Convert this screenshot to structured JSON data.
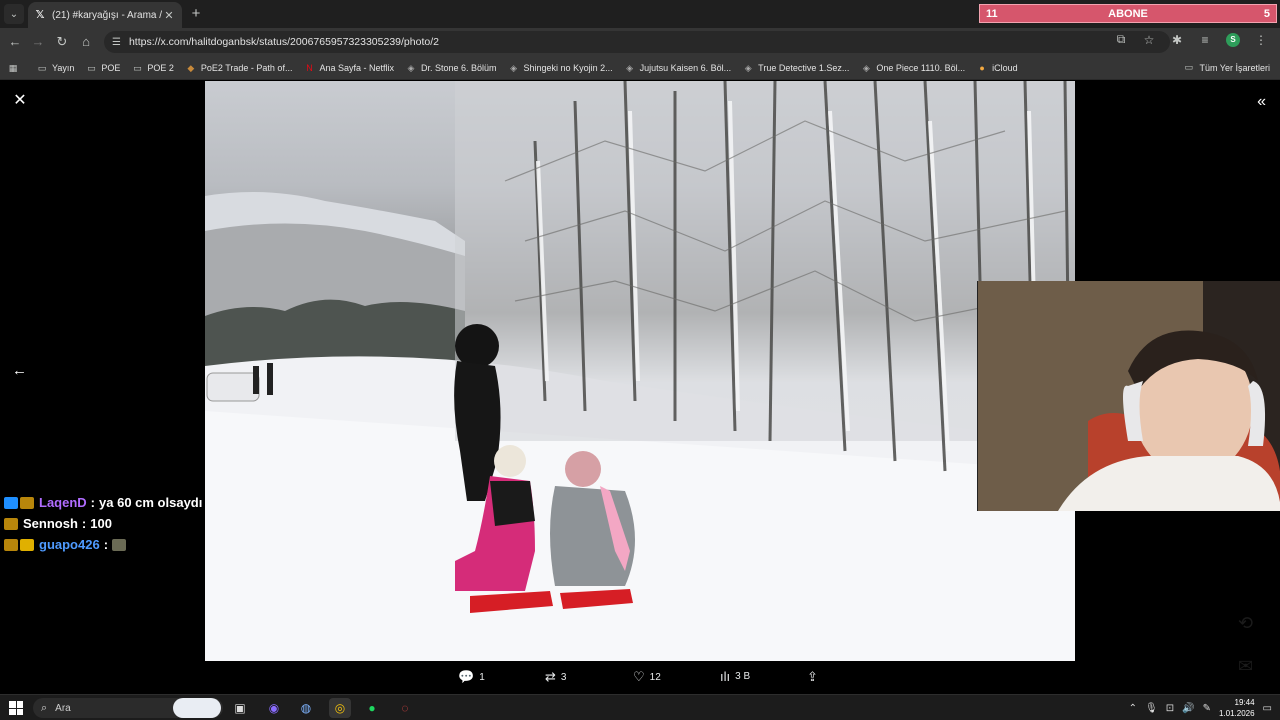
{
  "browser": {
    "tab": {
      "title": "(21) #karyağışı - Arama / X",
      "favicon": "x-logo-icon"
    },
    "url": "https://x.com/halitdoganbsk/status/2006765957323305239/photo/2",
    "abone": {
      "left": "11",
      "label": "ABONE",
      "right": "5"
    },
    "bookmarks": [
      {
        "label": "Yayın",
        "icon": "folder-icon"
      },
      {
        "label": "POE",
        "icon": "folder-icon"
      },
      {
        "label": "POE 2",
        "icon": "folder-icon"
      },
      {
        "label": "PoE2 Trade - Path of...",
        "icon": "poe-icon"
      },
      {
        "label": "Ana Sayfa - Netflix",
        "icon": "netflix-icon"
      },
      {
        "label": "Dr. Stone 6. Bölüm",
        "icon": "site-icon"
      },
      {
        "label": "Shingeki no Kyojin 2...",
        "icon": "site-icon"
      },
      {
        "label": "Jujutsu Kaisen 6. Böl...",
        "icon": "site-icon"
      },
      {
        "label": "True Detective 1.Sez...",
        "icon": "site-icon"
      },
      {
        "label": "One Piece 1110. Böl...",
        "icon": "site-icon"
      },
      {
        "label": "iCloud",
        "icon": "icloud-icon"
      }
    ],
    "all_bookmarks": "Tüm Yer İşaretleri"
  },
  "chat": [
    {
      "user": "LaqenD",
      "message": "ya 60 cm olsaydı",
      "color": "#b06cff"
    },
    {
      "user": "Sennosh",
      "message": "100",
      "color": "#ffffff"
    },
    {
      "user": "guapo426",
      "message": "",
      "color": "#4f9bff"
    }
  ],
  "post_actions": {
    "replies": "1",
    "reposts": "3",
    "likes": "12",
    "views": "3 B"
  },
  "taskbar": {
    "search_placeholder": "Ara",
    "time": "19:44",
    "date": "1.01.2026"
  }
}
